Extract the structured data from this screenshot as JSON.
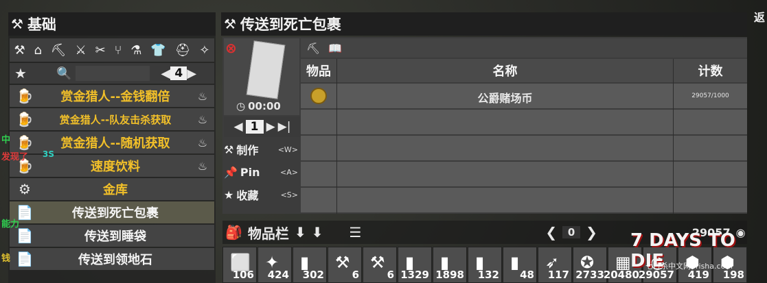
{
  "left": {
    "header": "基础",
    "page": "4",
    "recipes": [
      {
        "label": "赏金猎人--金钱翻倍",
        "color": "gold",
        "small": false,
        "trail": "♨"
      },
      {
        "label": "赏金猎人--队友击杀获取",
        "color": "gold",
        "small": true,
        "trail": "♨"
      },
      {
        "label": "赏金猎人--随机获取",
        "color": "gold",
        "small": false,
        "trail": "♨"
      },
      {
        "label": "速度饮料",
        "color": "gold",
        "small": false,
        "trail": "♨"
      },
      {
        "label": "金库",
        "color": "gold",
        "small": false,
        "trail": ""
      },
      {
        "label": "传送到死亡包裹",
        "color": "white",
        "small": false,
        "trail": ""
      },
      {
        "label": "传送到睡袋",
        "color": "white",
        "small": false,
        "trail": ""
      },
      {
        "label": "传送到领地石",
        "color": "white",
        "small": false,
        "trail": ""
      }
    ]
  },
  "detail": {
    "header": "传送到死亡包裹",
    "craft_time": "00:00",
    "quantity": "1",
    "actions": [
      {
        "label": "制作",
        "key": "<W>",
        "icon": "hammer-icon"
      },
      {
        "label": "Pin",
        "key": "<A>",
        "icon": "pin-icon"
      },
      {
        "label": "收藏",
        "key": "<S>",
        "icon": "star-icon"
      }
    ],
    "table": {
      "col_item": "物品",
      "col_name": "名称",
      "col_count": "计数",
      "rows": [
        {
          "name": "公爵赌场币",
          "count": "29057/1000"
        }
      ]
    }
  },
  "inventory": {
    "title": "物品栏",
    "page": "0",
    "currency": "29057",
    "slots": [
      "106",
      "424",
      "302",
      "6",
      "6",
      "1329",
      "1898",
      "132",
      "48",
      "117",
      "2733",
      "20480",
      "29057",
      "419",
      "198"
    ]
  },
  "side": {
    "left_texts": [
      "中",
      "发现了",
      "3S",
      "能力",
      "钱"
    ],
    "right_text": "返"
  },
  "watermark": {
    "logo": "7 DAYS TO DIE",
    "site": "七日杀中文网7risha.com"
  }
}
